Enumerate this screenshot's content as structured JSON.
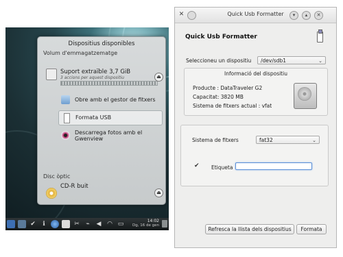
{
  "desktop": {
    "popup_title": "Dispositius disponibles",
    "storage_section": "Volum d'emmagatzematge",
    "device": {
      "name": "Suport extraïble 3,7 GiB",
      "subtitle": "3 accions per aquest dispositiu"
    },
    "actions": [
      {
        "label": "Obre amb el gestor de fitxers",
        "icon": "folder-icon"
      },
      {
        "label": "Formata USB",
        "icon": "usb-format-icon"
      },
      {
        "label": "Descarrega fotos amb el",
        "label2": "Gwenview",
        "icon": "gwenview-icon"
      }
    ],
    "optical_section": "Disc òptic",
    "cd": {
      "name": "CD-R buit"
    },
    "taskbar": {
      "time": "14:02",
      "date": "Dg, 16 de gen"
    }
  },
  "window": {
    "title": "Quick Usb Formatter",
    "heading": "Quick Usb Formatter",
    "select_device_label": "Seleccioneu un dispositiu",
    "selected_device": "/dev/sdb1",
    "info_title": "Informació del dispositiu",
    "product": "Producte : DataTraveler G2",
    "capacity": "Capacitat: 3820 MB",
    "filesystem": "Sistema de fitxers actual : vfat",
    "fs_label": "Sistema de fitxers",
    "fs_value": "fat32",
    "etiqueta_label": "Etiqueta",
    "etiqueta_value": "",
    "refresh_button": "Refresca la llista dels dispositius",
    "format_button": "Formata"
  },
  "colors": {
    "input_focus": "#5c8fd6",
    "wallpaper_dark": "#1b2f34"
  }
}
